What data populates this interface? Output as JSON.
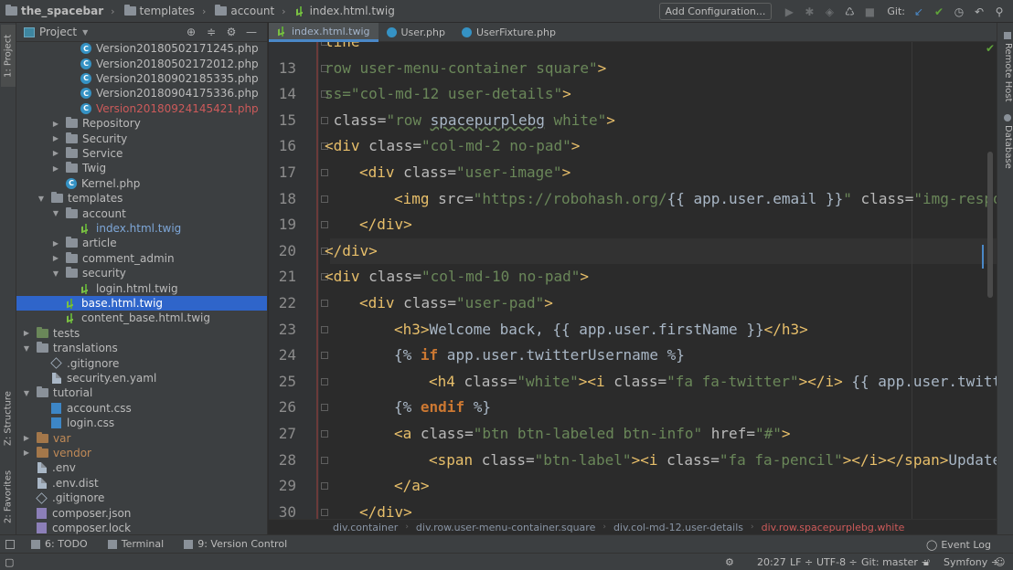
{
  "nav": {
    "project": "the_spacebar",
    "crumbs": [
      "templates",
      "account"
    ],
    "file": "index.html.twig"
  },
  "toolbar": {
    "add_config": "Add Configuration...",
    "git_label": "Git:"
  },
  "left_strip": {
    "project_tab": "1: Project",
    "structure_tab": "Z: Structure",
    "favorites_tab": "2: Favorites"
  },
  "right_strip": {
    "remote_host": "Remote Host",
    "database": "Database"
  },
  "project_panel": {
    "title": "Project",
    "items": [
      {
        "label": "Version20180502171245.php",
        "depth": 4,
        "icon": "php-class-icon",
        "arrow": "",
        "color": "normal"
      },
      {
        "label": "Version20180502172012.php",
        "depth": 4,
        "icon": "php-class-icon",
        "arrow": "",
        "color": "normal"
      },
      {
        "label": "Version20180902185335.php",
        "depth": 4,
        "icon": "php-class-icon",
        "arrow": "",
        "color": "normal"
      },
      {
        "label": "Version20180904175336.php",
        "depth": 4,
        "icon": "php-class-icon",
        "arrow": "",
        "color": "normal"
      },
      {
        "label": "Version20180924145421.php",
        "depth": 4,
        "icon": "php-class-icon",
        "arrow": "",
        "color": "red"
      },
      {
        "label": "Repository",
        "depth": 3,
        "icon": "folder-icon",
        "arrow": "right",
        "color": "normal"
      },
      {
        "label": "Security",
        "depth": 3,
        "icon": "folder-icon",
        "arrow": "right",
        "color": "normal"
      },
      {
        "label": "Service",
        "depth": 3,
        "icon": "folder-icon",
        "arrow": "right",
        "color": "normal"
      },
      {
        "label": "Twig",
        "depth": 3,
        "icon": "folder-icon",
        "arrow": "right",
        "color": "normal"
      },
      {
        "label": "Kernel.php",
        "depth": 3,
        "icon": "php-class-icon",
        "arrow": "",
        "color": "normal"
      },
      {
        "label": "templates",
        "depth": 2,
        "icon": "folder-icon",
        "arrow": "down",
        "color": "normal"
      },
      {
        "label": "account",
        "depth": 3,
        "icon": "folder-icon",
        "arrow": "down",
        "color": "normal"
      },
      {
        "label": "index.html.twig",
        "depth": 4,
        "icon": "twig-icon",
        "arrow": "",
        "color": "blue"
      },
      {
        "label": "article",
        "depth": 3,
        "icon": "folder-icon",
        "arrow": "right",
        "color": "normal"
      },
      {
        "label": "comment_admin",
        "depth": 3,
        "icon": "folder-icon",
        "arrow": "right",
        "color": "normal"
      },
      {
        "label": "security",
        "depth": 3,
        "icon": "folder-icon",
        "arrow": "down",
        "color": "normal"
      },
      {
        "label": "login.html.twig",
        "depth": 4,
        "icon": "twig-icon",
        "arrow": "",
        "color": "normal"
      },
      {
        "label": "base.html.twig",
        "depth": 3,
        "icon": "twig-icon",
        "arrow": "",
        "color": "selected"
      },
      {
        "label": "content_base.html.twig",
        "depth": 3,
        "icon": "twig-icon",
        "arrow": "",
        "color": "normal"
      },
      {
        "label": "tests",
        "depth": 1,
        "icon": "green-folder-icon",
        "arrow": "right",
        "color": "normal"
      },
      {
        "label": "translations",
        "depth": 1,
        "icon": "folder-icon",
        "arrow": "down",
        "color": "normal"
      },
      {
        "label": ".gitignore",
        "depth": 2,
        "icon": "gitignore-icon",
        "arrow": "",
        "color": "normal"
      },
      {
        "label": "security.en.yaml",
        "depth": 2,
        "icon": "file-icon",
        "arrow": "",
        "color": "normal"
      },
      {
        "label": "tutorial",
        "depth": 1,
        "icon": "folder-icon",
        "arrow": "down",
        "color": "normal"
      },
      {
        "label": "account.css",
        "depth": 2,
        "icon": "css-icon",
        "arrow": "",
        "color": "normal"
      },
      {
        "label": "login.css",
        "depth": 2,
        "icon": "css-icon",
        "arrow": "",
        "color": "normal"
      },
      {
        "label": "var",
        "depth": 1,
        "icon": "orange-folder-icon",
        "arrow": "right",
        "color": "orange"
      },
      {
        "label": "vendor",
        "depth": 1,
        "icon": "orange-folder-icon",
        "arrow": "right",
        "color": "orange"
      },
      {
        "label": ".env",
        "depth": 1,
        "icon": "file-icon",
        "arrow": "",
        "color": "normal"
      },
      {
        "label": ".env.dist",
        "depth": 1,
        "icon": "file-icon",
        "arrow": "",
        "color": "normal"
      },
      {
        "label": ".gitignore",
        "depth": 1,
        "icon": "gitignore-icon",
        "arrow": "",
        "color": "normal"
      },
      {
        "label": "composer.json",
        "depth": 1,
        "icon": "json-icon",
        "arrow": "",
        "color": "normal"
      },
      {
        "label": "composer.lock",
        "depth": 1,
        "icon": "json-icon",
        "arrow": "",
        "color": "normal"
      }
    ]
  },
  "tabs": [
    {
      "label": "index.html.twig",
      "active": true,
      "icon": "twig-icon"
    },
    {
      "label": "User.php",
      "active": false,
      "icon": "php-class-icon"
    },
    {
      "label": "UserFixture.php",
      "active": false,
      "icon": "php-class-icon"
    }
  ],
  "editor": {
    "current_line": "20",
    "lines": [
      {
        "n": "",
        "indent": 0,
        "parts": [
          [
            "tg",
            "line\""
          ]
        ]
      },
      {
        "n": "13",
        "indent": 0,
        "parts": [
          [
            "st",
            "row user-menu-container square"
          ],
          [
            "st",
            "\""
          ],
          [
            "tg",
            ">"
          ]
        ]
      },
      {
        "n": "14",
        "indent": 0,
        "parts": [
          [
            "st",
            "ss=\"col-md-12 user-details\""
          ],
          [
            "tg",
            ">"
          ]
        ]
      },
      {
        "n": "15",
        "indent": 0,
        "parts": [
          [
            "tg",
            " "
          ],
          [
            "at",
            "class="
          ],
          [
            "st",
            "\"row "
          ],
          [
            "ul",
            "spacepurplebg"
          ],
          [
            "st",
            " white\""
          ],
          [
            "tg",
            ">"
          ]
        ]
      },
      {
        "n": "16",
        "indent": 0,
        "parts": [
          [
            "tg",
            "<div "
          ],
          [
            "at",
            "class="
          ],
          [
            "st",
            "\"col-md-2 no-pad\""
          ],
          [
            "tg",
            ">"
          ]
        ]
      },
      {
        "n": "17",
        "indent": 1,
        "parts": [
          [
            "tg",
            "<div "
          ],
          [
            "at",
            "class="
          ],
          [
            "st",
            "\"user-image\""
          ],
          [
            "tg",
            ">"
          ]
        ]
      },
      {
        "n": "18",
        "indent": 2,
        "parts": [
          [
            "tg",
            "<img "
          ],
          [
            "at",
            "src="
          ],
          [
            "st",
            "\"https://robohash.org/"
          ],
          [
            "tv",
            "{{ app.user.email }}"
          ],
          [
            "st",
            "\" "
          ],
          [
            "at",
            "class="
          ],
          [
            "st",
            "\"img-respo"
          ]
        ]
      },
      {
        "n": "19",
        "indent": 1,
        "parts": [
          [
            "tg",
            "</div>"
          ]
        ]
      },
      {
        "n": "20",
        "indent": 0,
        "parts": [
          [
            "tg",
            "</div>"
          ]
        ]
      },
      {
        "n": "21",
        "indent": 0,
        "parts": [
          [
            "tg",
            "<div "
          ],
          [
            "at",
            "class="
          ],
          [
            "st",
            "\"col-md-10 no-pad\""
          ],
          [
            "tg",
            ">"
          ]
        ]
      },
      {
        "n": "22",
        "indent": 1,
        "parts": [
          [
            "tg",
            "<div "
          ],
          [
            "at",
            "class="
          ],
          [
            "st",
            "\"user-pad\""
          ],
          [
            "tg",
            ">"
          ]
        ]
      },
      {
        "n": "23",
        "indent": 2,
        "parts": [
          [
            "tg",
            "<h3>"
          ],
          [
            "tv",
            "Welcome back, {{ app.user.firstName }}"
          ],
          [
            "tg",
            "</h3>"
          ]
        ]
      },
      {
        "n": "24",
        "indent": 2,
        "parts": [
          [
            "tv",
            "{% "
          ],
          [
            "tw",
            "if"
          ],
          [
            "tv",
            " app.user.twitterUsername %}"
          ]
        ]
      },
      {
        "n": "25",
        "indent": 3,
        "parts": [
          [
            "tg",
            "<h4 "
          ],
          [
            "at",
            "class="
          ],
          [
            "st",
            "\"white\""
          ],
          [
            "tg",
            "><i "
          ],
          [
            "at",
            "class="
          ],
          [
            "st",
            "\"fa fa-twitter\""
          ],
          [
            "tg",
            "></i>"
          ],
          [
            "tv",
            " {{ app.user.twitt"
          ]
        ]
      },
      {
        "n": "26",
        "indent": 2,
        "parts": [
          [
            "tv",
            "{% "
          ],
          [
            "tw",
            "endif"
          ],
          [
            "tv",
            " %}"
          ]
        ]
      },
      {
        "n": "27",
        "indent": 2,
        "parts": [
          [
            "tg",
            "<a "
          ],
          [
            "at",
            "class="
          ],
          [
            "st",
            "\"btn btn-labeled btn-info\""
          ],
          [
            "at",
            " href="
          ],
          [
            "st",
            "\"#\""
          ],
          [
            "tg",
            ">"
          ]
        ]
      },
      {
        "n": "28",
        "indent": 3,
        "parts": [
          [
            "tg",
            "<span "
          ],
          [
            "at",
            "class="
          ],
          [
            "st",
            "\"btn-label\""
          ],
          [
            "tg",
            "><i "
          ],
          [
            "at",
            "class="
          ],
          [
            "st",
            "\"fa fa-pencil\""
          ],
          [
            "tg",
            "></i></span>"
          ],
          [
            "tv",
            "Update"
          ]
        ]
      },
      {
        "n": "29",
        "indent": 2,
        "parts": [
          [
            "tg",
            "</a>"
          ]
        ]
      },
      {
        "n": "30",
        "indent": 1,
        "parts": [
          [
            "tg",
            "</div>"
          ]
        ]
      }
    ]
  },
  "breadcrumbs": [
    "div.container",
    "div.row.user-menu-container.square",
    "div.col-md-12.user-details",
    "div.row.spacepurplebg.white"
  ],
  "bottom_tools": {
    "todo": "6: TODO",
    "terminal": "Terminal",
    "vcs": "9: Version Control",
    "event_log": "Event Log"
  },
  "status": {
    "position": "20:27",
    "line_sep": "LF ÷",
    "encoding": "UTF-8 ÷",
    "git": "Git: master ÷",
    "framework": "Symfony ÷"
  }
}
